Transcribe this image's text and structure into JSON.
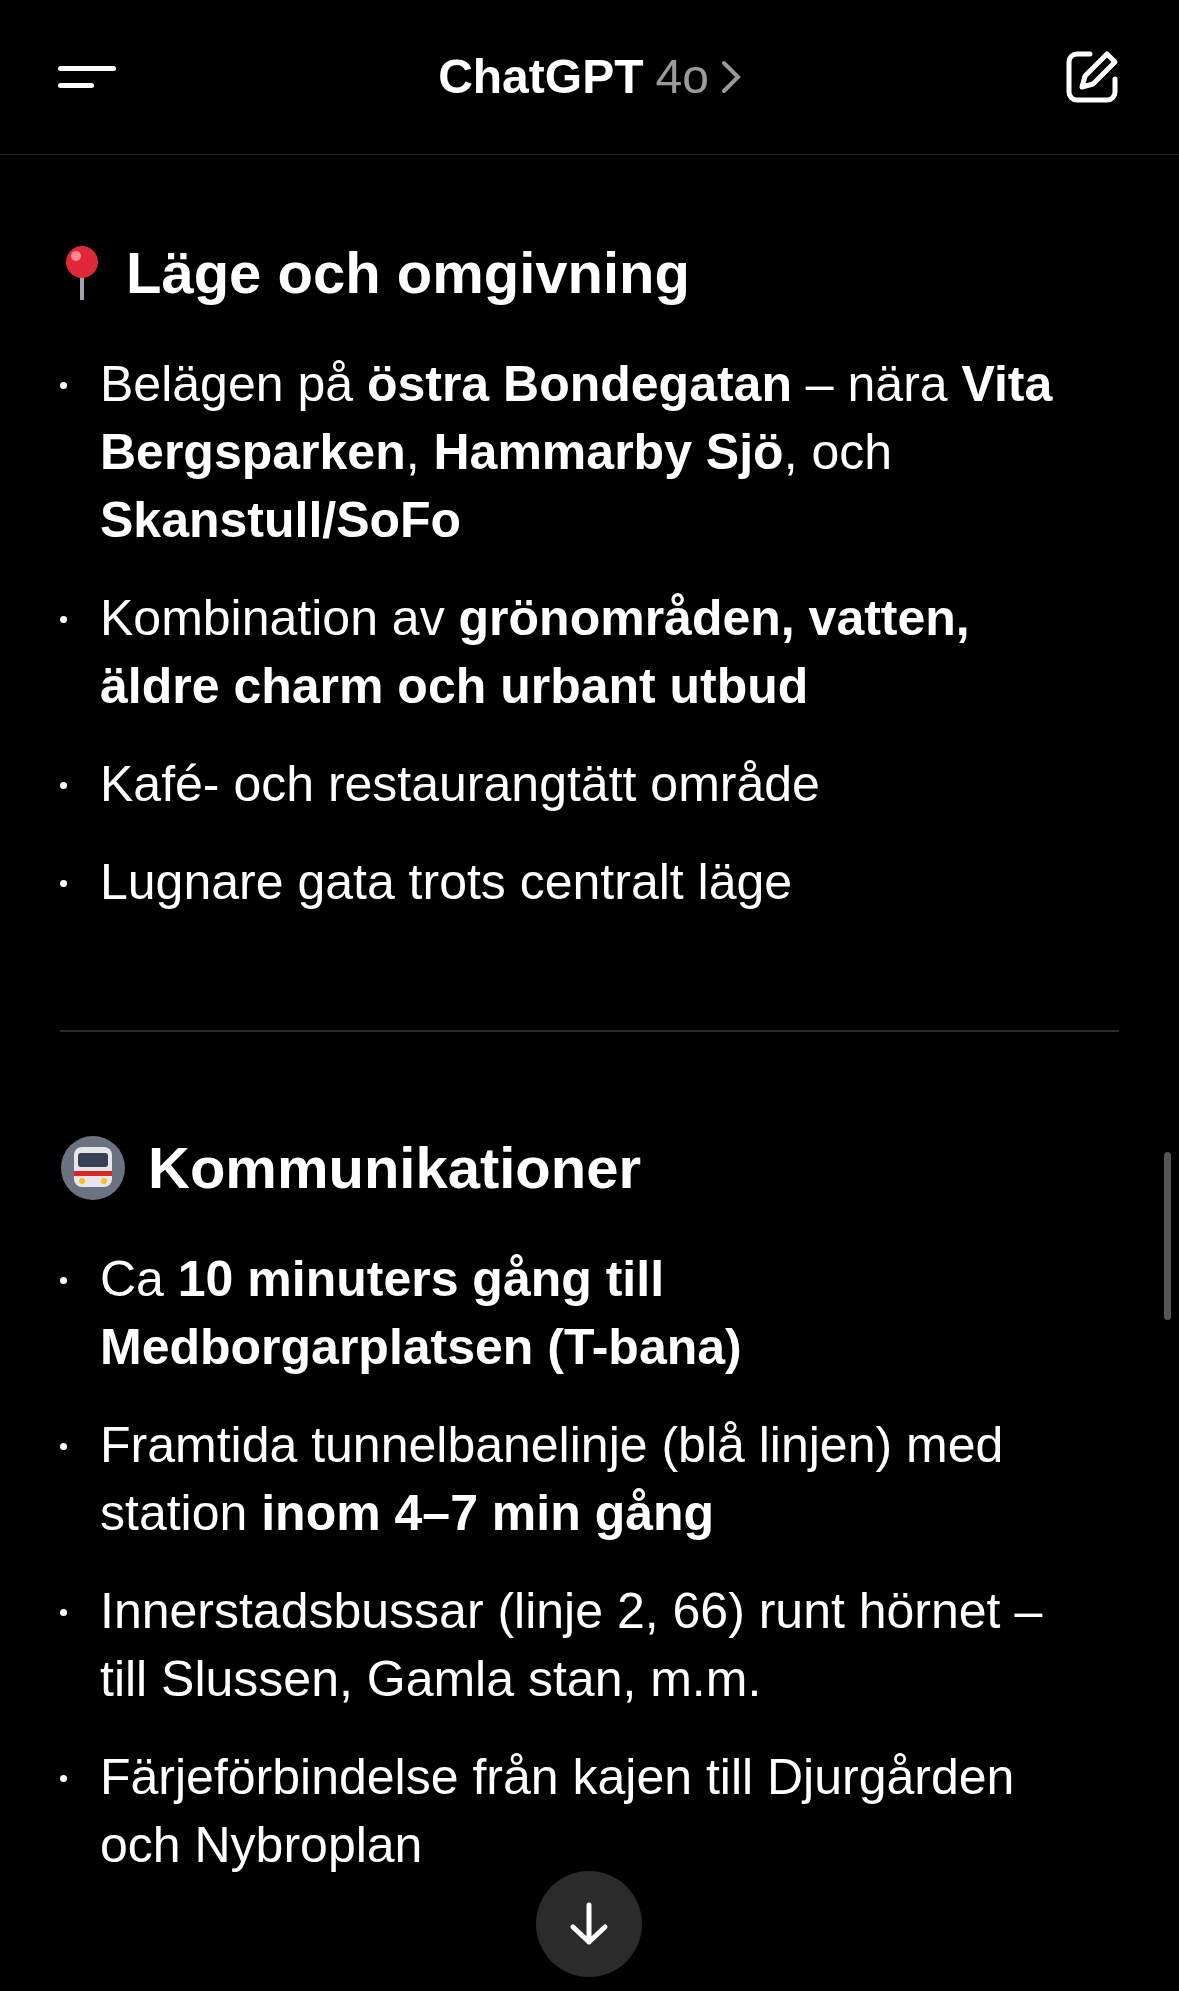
{
  "header": {
    "title": "ChatGPT",
    "model": "4o"
  },
  "sections": [
    {
      "kind": "pin",
      "heading": "Läge och omgivning",
      "bullets": [
        "Belägen på **östra Bondegatan** – nära **Vita Bergsparken**, **Hammarby Sjö**, och **Skanstull/SoFo**",
        "Kombination av **grönområden, vatten, äldre charm och urbant utbud**",
        "Kafé- och restaurangtätt område",
        "Lugnare gata trots centralt läge"
      ]
    },
    {
      "kind": "train",
      "heading": "Kommunikationer",
      "bullets": [
        "Ca **10 minuters gång till Medborgarplatsen (T-bana)**",
        "Framtida tunnelbanelinje (blå linjen) med station **inom 4–7 min gång**",
        "Innerstadsbussar (linje 2, 66) runt hörnet – till Slussen, Gamla stan, m.m.",
        "Färjeförbindelse från kajen till Djurgården och Nybroplan"
      ]
    }
  ]
}
